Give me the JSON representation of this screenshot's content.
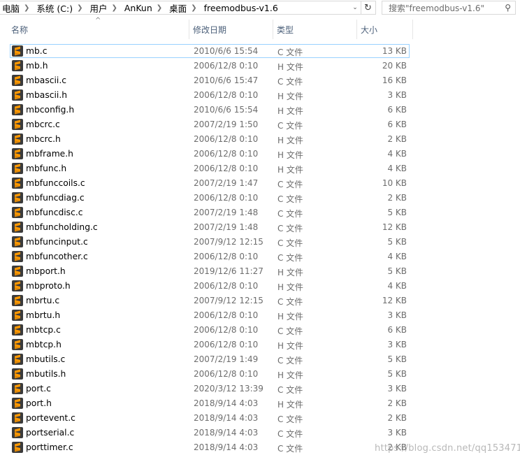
{
  "address_bar": {
    "crumbs": [
      "电脑",
      "系统 (C:)",
      "用户",
      "AnKun",
      "桌面",
      "freemodbus-v1.6"
    ]
  },
  "search": {
    "placeholder": "搜索\"freemodbus-v1.6\""
  },
  "columns": {
    "name": "名称",
    "date": "修改日期",
    "type": "类型",
    "size": "大小"
  },
  "icon": {
    "name": "sublime-text-file-icon",
    "bg": "#3b3b3b",
    "accent": "#ff9800"
  },
  "files": [
    {
      "name": "mb.c",
      "date": "2010/6/6 15:54",
      "type": "C 文件",
      "size": "13 KB"
    },
    {
      "name": "mb.h",
      "date": "2006/12/8 0:10",
      "type": "H 文件",
      "size": "20 KB"
    },
    {
      "name": "mbascii.c",
      "date": "2010/6/6 15:47",
      "type": "C 文件",
      "size": "16 KB"
    },
    {
      "name": "mbascii.h",
      "date": "2006/12/8 0:10",
      "type": "H 文件",
      "size": "3 KB"
    },
    {
      "name": "mbconfig.h",
      "date": "2010/6/6 15:54",
      "type": "H 文件",
      "size": "6 KB"
    },
    {
      "name": "mbcrc.c",
      "date": "2007/2/19 1:50",
      "type": "C 文件",
      "size": "6 KB"
    },
    {
      "name": "mbcrc.h",
      "date": "2006/12/8 0:10",
      "type": "H 文件",
      "size": "2 KB"
    },
    {
      "name": "mbframe.h",
      "date": "2006/12/8 0:10",
      "type": "H 文件",
      "size": "4 KB"
    },
    {
      "name": "mbfunc.h",
      "date": "2006/12/8 0:10",
      "type": "H 文件",
      "size": "4 KB"
    },
    {
      "name": "mbfunccoils.c",
      "date": "2007/2/19 1:47",
      "type": "C 文件",
      "size": "10 KB"
    },
    {
      "name": "mbfuncdiag.c",
      "date": "2006/12/8 0:10",
      "type": "C 文件",
      "size": "2 KB"
    },
    {
      "name": "mbfuncdisc.c",
      "date": "2007/2/19 1:48",
      "type": "C 文件",
      "size": "5 KB"
    },
    {
      "name": "mbfuncholding.c",
      "date": "2007/2/19 1:48",
      "type": "C 文件",
      "size": "12 KB"
    },
    {
      "name": "mbfuncinput.c",
      "date": "2007/9/12 12:15",
      "type": "C 文件",
      "size": "5 KB"
    },
    {
      "name": "mbfuncother.c",
      "date": "2006/12/8 0:10",
      "type": "C 文件",
      "size": "4 KB"
    },
    {
      "name": "mbport.h",
      "date": "2019/12/6 11:27",
      "type": "H 文件",
      "size": "5 KB"
    },
    {
      "name": "mbproto.h",
      "date": "2006/12/8 0:10",
      "type": "H 文件",
      "size": "4 KB"
    },
    {
      "name": "mbrtu.c",
      "date": "2007/9/12 12:15",
      "type": "C 文件",
      "size": "12 KB"
    },
    {
      "name": "mbrtu.h",
      "date": "2006/12/8 0:10",
      "type": "H 文件",
      "size": "3 KB"
    },
    {
      "name": "mbtcp.c",
      "date": "2006/12/8 0:10",
      "type": "C 文件",
      "size": "6 KB"
    },
    {
      "name": "mbtcp.h",
      "date": "2006/12/8 0:10",
      "type": "H 文件",
      "size": "3 KB"
    },
    {
      "name": "mbutils.c",
      "date": "2007/2/19 1:49",
      "type": "C 文件",
      "size": "5 KB"
    },
    {
      "name": "mbutils.h",
      "date": "2006/12/8 0:10",
      "type": "H 文件",
      "size": "5 KB"
    },
    {
      "name": "port.c",
      "date": "2020/3/12 13:39",
      "type": "C 文件",
      "size": "3 KB"
    },
    {
      "name": "port.h",
      "date": "2018/9/14 4:03",
      "type": "H 文件",
      "size": "2 KB"
    },
    {
      "name": "portevent.c",
      "date": "2018/9/14 4:03",
      "type": "C 文件",
      "size": "2 KB"
    },
    {
      "name": "portserial.c",
      "date": "2018/9/14 4:03",
      "type": "C 文件",
      "size": "3 KB"
    },
    {
      "name": "porttimer.c",
      "date": "2018/9/14 4:03",
      "type": "C 文件",
      "size": "2 KB"
    }
  ],
  "selected_index": 0,
  "watermark": "https://blog.csdn.net/qq153471503"
}
